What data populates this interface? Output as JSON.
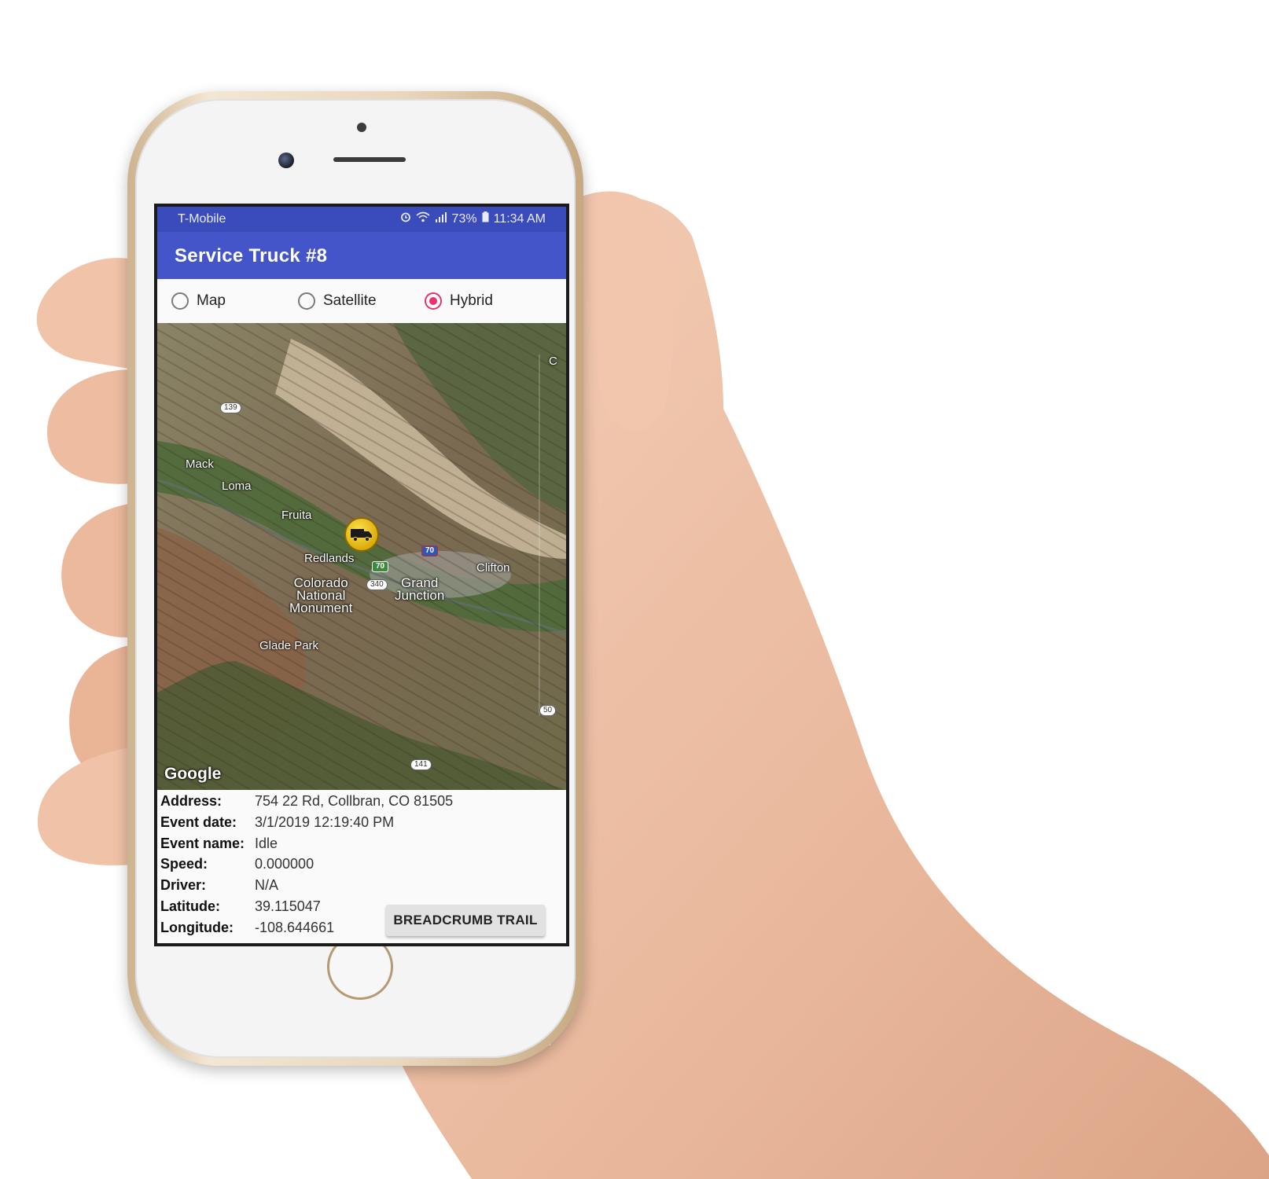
{
  "status_bar": {
    "carrier": "T-Mobile",
    "battery": "73%",
    "time": "11:34 AM",
    "icons": [
      "alarm-icon",
      "wifi-icon",
      "signal-icon",
      "battery-icon"
    ]
  },
  "app_bar": {
    "title": "Service Truck #8"
  },
  "map_type": {
    "options": [
      {
        "label": "Map",
        "checked": false
      },
      {
        "label": "Satellite",
        "checked": false
      },
      {
        "label": "Hybrid",
        "checked": true
      }
    ],
    "accent": "#e8336b"
  },
  "map": {
    "labels": {
      "mack": "Mack",
      "loma": "Loma",
      "fruita": "Fruita",
      "redlands": "Redlands",
      "colorado_nm": "Colorado\nNational\nMonument",
      "grand_junction": "Grand\nJunction",
      "clifton": "Clifton",
      "glade_park": "Glade Park",
      "edge_c": "C"
    },
    "shields": {
      "r139": "139",
      "i70_east": "70",
      "us70": "70",
      "r340": "340",
      "r50": "50",
      "r141": "141"
    },
    "attribution": "Google",
    "marker_icon": "truck-icon"
  },
  "details": {
    "address_label": "Address:",
    "address": "754 22 Rd, Collbran, CO 81505",
    "event_date_label": "Event date:",
    "event_date": "3/1/2019 12:19:40 PM",
    "event_name_label": "Event name:",
    "event_name": "Idle",
    "speed_label": "Speed:",
    "speed": "0.000000",
    "driver_label": "Driver:",
    "driver": "N/A",
    "latitude_label": "Latitude:",
    "latitude": "39.115047",
    "longitude_label": "Longitude:",
    "longitude": "-108.644661"
  },
  "breadcrumb_button": "BREADCRUMB TRAIL",
  "colors": {
    "app_bar": "#4355c8",
    "status_bar": "#3a4bbb",
    "phone_frame": "#e9d7bd"
  }
}
